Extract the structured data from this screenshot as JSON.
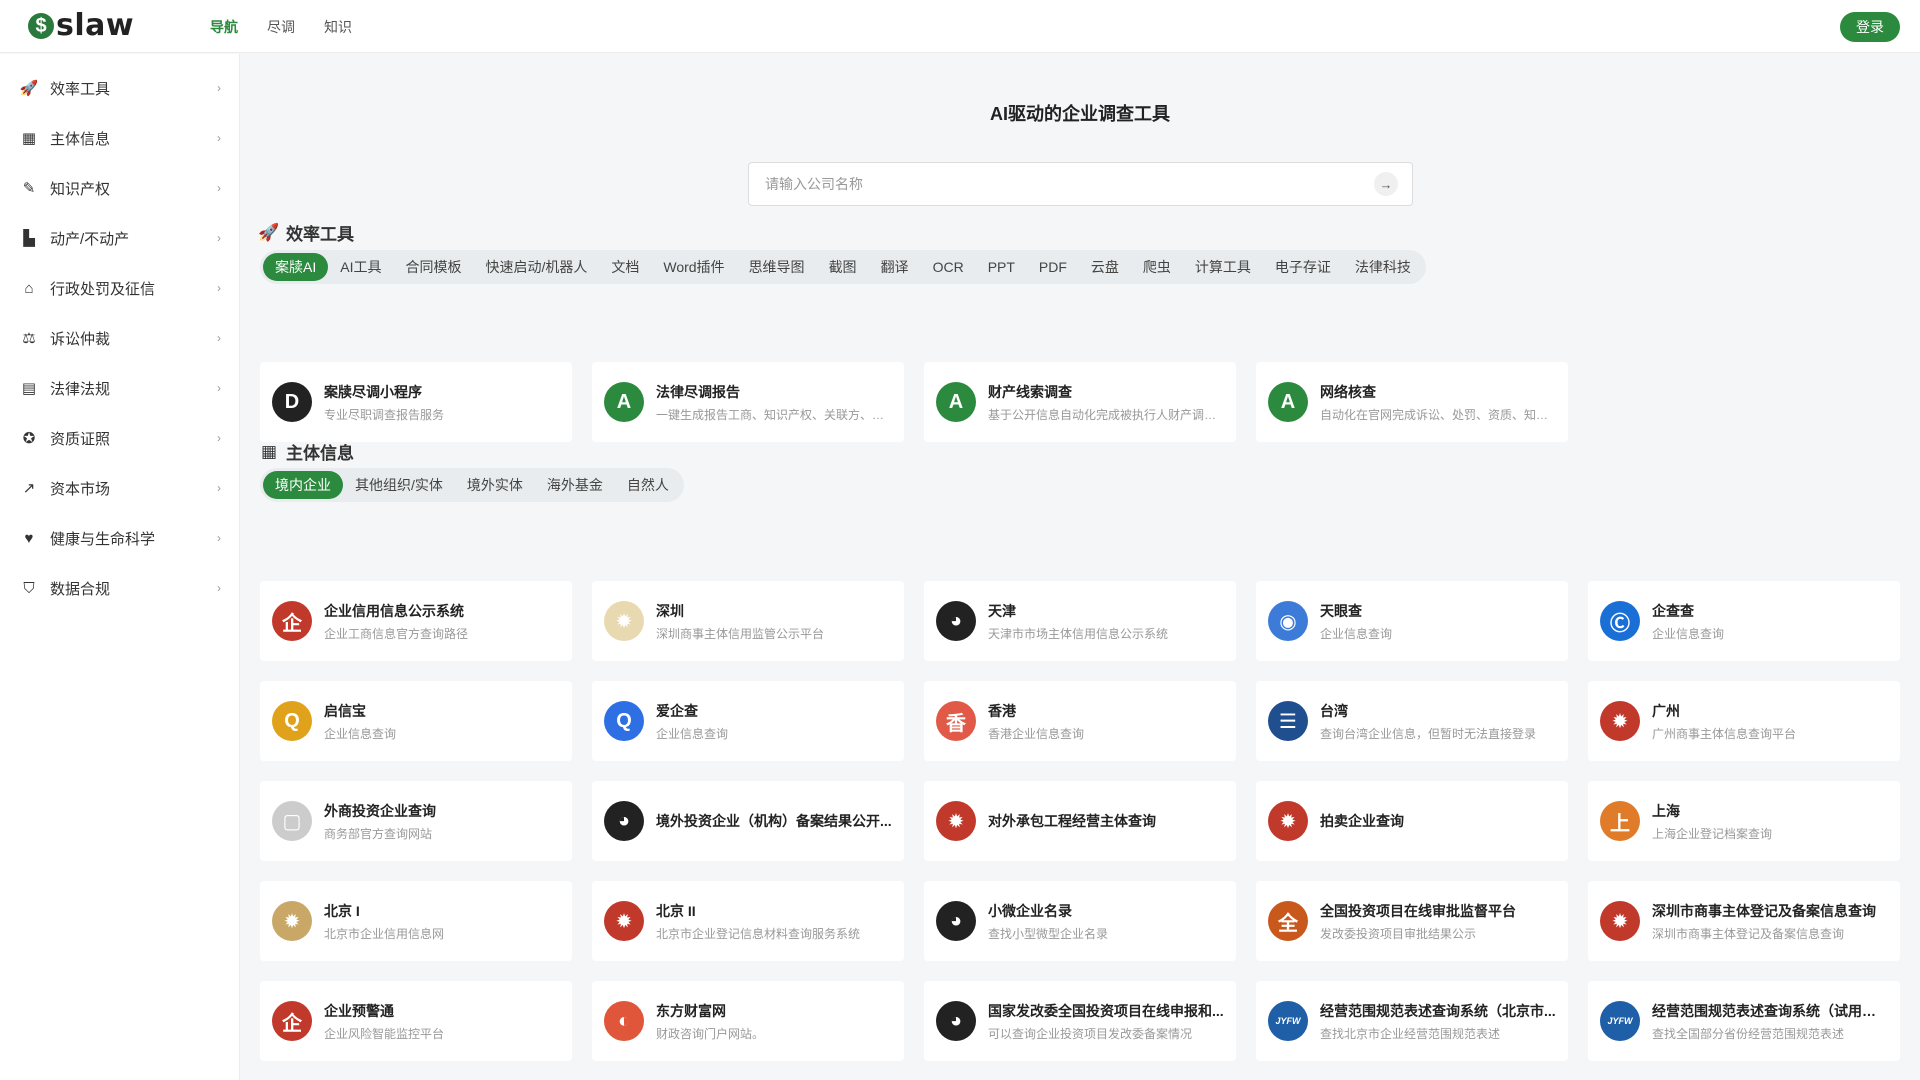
{
  "app": {
    "logo_text": "slaw",
    "logo_mark": "$"
  },
  "topnav": [
    {
      "label": "导航",
      "active": true
    },
    {
      "label": "尽调",
      "active": false
    },
    {
      "label": "知识",
      "active": false
    }
  ],
  "login_label": "登录",
  "sidebar": {
    "items": [
      {
        "label": "效率工具",
        "icon": "rocket-icon",
        "glyph": "🚀"
      },
      {
        "label": "主体信息",
        "icon": "building-icon",
        "glyph": "▦"
      },
      {
        "label": "知识产权",
        "icon": "lightbulb-icon",
        "glyph": "✎"
      },
      {
        "label": "动产/不动产",
        "icon": "property-icon",
        "glyph": "▙"
      },
      {
        "label": "行政处罚及征信",
        "icon": "government-icon",
        "glyph": "⌂"
      },
      {
        "label": "诉讼仲裁",
        "icon": "scale-icon",
        "glyph": "⚖"
      },
      {
        "label": "法律法规",
        "icon": "book-icon",
        "glyph": "▤"
      },
      {
        "label": "资质证照",
        "icon": "certificate-icon",
        "glyph": "✪"
      },
      {
        "label": "资本市场",
        "icon": "chart-icon",
        "glyph": "↗"
      },
      {
        "label": "健康与生命科学",
        "icon": "heart-pulse-icon",
        "glyph": "♥"
      },
      {
        "label": "数据合规",
        "icon": "shield-icon",
        "glyph": "⛉"
      }
    ]
  },
  "hero": {
    "title": "AI驱动的企业调查工具",
    "search_placeholder": "请输入公司名称"
  },
  "sections": [
    {
      "title": "效率工具",
      "icon": "rocket-icon",
      "glyph": "🚀",
      "tabs": [
        "案牍AI",
        "AI工具",
        "合同模板",
        "快速启动/机器人",
        "文档",
        "Word插件",
        "思维导图",
        "截图",
        "翻译",
        "OCR",
        "PPT",
        "PDF",
        "云盘",
        "爬虫",
        "计算工具",
        "电子存证",
        "法律科技"
      ],
      "active_tab": 0,
      "cards": [
        {
          "title": "案牍尽调小程序",
          "desc": "专业尽职调查报告服务",
          "icon": "qr-code-icon",
          "glyph": "D",
          "color": "#222222"
        },
        {
          "title": "法律尽调报告",
          "desc": "一键生成报告工商、知识产权、关联方、诉...",
          "icon": "autodocs-logo-icon",
          "glyph": "A",
          "color": "#2b8a3e"
        },
        {
          "title": "财产线索调查",
          "desc": "基于公开信息自动化完成被执行人财产调查...",
          "icon": "autodocs-logo-icon",
          "glyph": "A",
          "color": "#2b8a3e"
        },
        {
          "title": "网络核查",
          "desc": "自动化在官网完成诉讼、处罚、资质、知识...",
          "icon": "autodocs-logo-icon",
          "glyph": "A",
          "color": "#2b8a3e"
        }
      ]
    },
    {
      "title": "主体信息",
      "icon": "building-icon",
      "glyph": "▦",
      "tabs": [
        "境内企业",
        "其他组织/实体",
        "境外实体",
        "海外基金",
        "自然人"
      ],
      "active_tab": 0,
      "cards": [
        {
          "title": "企业信用信息公示系统",
          "desc": "企业工商信息官方查询路径",
          "icon": "qi-logo-icon",
          "glyph": "企",
          "color": "#c0392b"
        },
        {
          "title": "深圳",
          "desc": "深圳商事主体信用监管公示平台",
          "icon": "emblem-icon",
          "glyph": "✹",
          "color": "#e8d9b0"
        },
        {
          "title": "天津",
          "desc": "天津市市场主体信用信息公示系统",
          "icon": "globe-icon",
          "glyph": "◕",
          "color": "#222222"
        },
        {
          "title": "天眼查",
          "desc": "企业信息查询",
          "icon": "tianyancha-logo-icon",
          "glyph": "◉",
          "color": "#3d7bd9"
        },
        {
          "title": "企查查",
          "desc": "企业信息查询",
          "icon": "qichacha-logo-icon",
          "glyph": "Ⓒ",
          "color": "#1a6fd6"
        },
        {
          "title": "启信宝",
          "desc": "企业信息查询",
          "icon": "qixinbao-logo-icon",
          "glyph": "Q",
          "color": "#e0a21a"
        },
        {
          "title": "爱企查",
          "desc": "企业信息查询",
          "icon": "aiqicha-logo-icon",
          "glyph": "Q",
          "color": "#2f6fe4"
        },
        {
          "title": "香港",
          "desc": "香港企业信息查询",
          "icon": "xiang-logo-icon",
          "glyph": "香",
          "color": "#e05a47"
        },
        {
          "title": "台湾",
          "desc": "查询台湾企业信息，但暂时无法直接登录",
          "icon": "list-icon",
          "glyph": "☰",
          "color": "#1f4f8f"
        },
        {
          "title": "广州",
          "desc": "广州商事主体信息查询平台",
          "icon": "emblem-icon",
          "glyph": "✹",
          "color": "#c0392b"
        },
        {
          "title": "外商投资企业查询",
          "desc": "商务部官方查询网站",
          "icon": "document-icon",
          "glyph": "▢",
          "color": "#cccccc"
        },
        {
          "title": "境外投资企业（机构）备案结果公开...",
          "desc": "",
          "icon": "globe-icon",
          "glyph": "◕",
          "color": "#222222"
        },
        {
          "title": "对外承包工程经营主体查询",
          "desc": "",
          "icon": "emblem-icon",
          "glyph": "✹",
          "color": "#c0392b"
        },
        {
          "title": "拍卖企业查询",
          "desc": "",
          "icon": "emblem-icon",
          "glyph": "✹",
          "color": "#c0392b"
        },
        {
          "title": "上海",
          "desc": "上海企业登记档案查询",
          "icon": "shang-logo-icon",
          "glyph": "上",
          "color": "#e07b2a"
        },
        {
          "title": "北京 I",
          "desc": "北京市企业信用信息网",
          "icon": "emblem-icon",
          "glyph": "✹",
          "color": "#c9a867"
        },
        {
          "title": "北京 II",
          "desc": "北京市企业登记信息材料查询服务系统",
          "icon": "emblem-icon",
          "glyph": "✹",
          "color": "#c0392b"
        },
        {
          "title": "小微企业名录",
          "desc": "查找小型微型企业名录",
          "icon": "globe-icon",
          "glyph": "◕",
          "color": "#222222"
        },
        {
          "title": "全国投资项目在线审批监督平台",
          "desc": "发改委投资项目审批结果公示",
          "icon": "quan-logo-icon",
          "glyph": "全",
          "color": "#c9581d"
        },
        {
          "title": "深圳市商事主体登记及备案信息查询",
          "desc": "深圳市商事主体登记及备案信息查询",
          "icon": "emblem-icon",
          "glyph": "✹",
          "color": "#c0392b"
        },
        {
          "title": "企业预警通",
          "desc": "企业风险智能监控平台",
          "icon": "qi-logo-icon",
          "glyph": "企",
          "color": "#c0392b"
        },
        {
          "title": "东方财富网",
          "desc": "财政咨询门户网站。",
          "icon": "eastmoney-logo-icon",
          "glyph": "◐",
          "color": "#e0563a"
        },
        {
          "title": "国家发改委全国投资项目在线申报和...",
          "desc": "可以查询企业投资项目发改委备案情况",
          "icon": "globe-icon",
          "glyph": "◕",
          "color": "#222222"
        },
        {
          "title": "经营范围规范表述查询系统（北京市...",
          "desc": "查找北京市企业经营范围规范表述",
          "icon": "jyfw-logo-icon",
          "glyph": "JYFW",
          "color": "#1f5fa8"
        },
        {
          "title": "经营范围规范表述查询系统（试用版）",
          "desc": "查找全国部分省份经营范围规范表述",
          "icon": "jyfw-logo-icon",
          "glyph": "JYFW",
          "color": "#1f5fa8"
        }
      ]
    }
  ]
}
